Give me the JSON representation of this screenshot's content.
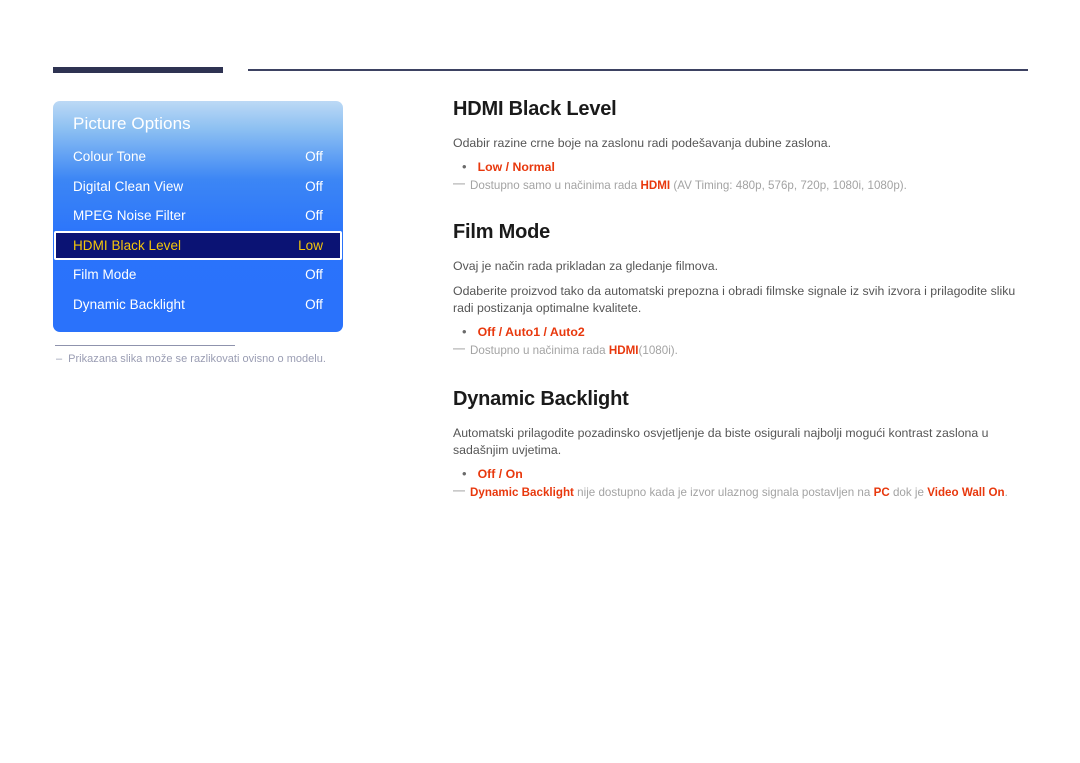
{
  "page": {
    "title": "Picture Options - HDMI Black Level / Film Mode / Dynamic Backlight",
    "accent_color": "#e8380d",
    "rule_color": "#2e3352",
    "osd_highlight_color": "#f5c60a",
    "osd_highlight_bg": "#0b1374"
  },
  "osd": {
    "title": "Picture Options",
    "rows": [
      {
        "label": "Colour Tone",
        "value": "Off",
        "selected": false
      },
      {
        "label": "Digital Clean View",
        "value": "Off",
        "selected": false
      },
      {
        "label": "MPEG Noise Filter",
        "value": "Off",
        "selected": false
      },
      {
        "label": "HDMI Black Level",
        "value": "Low",
        "selected": true
      },
      {
        "label": "Film Mode",
        "value": "Off",
        "selected": false
      },
      {
        "label": "Dynamic Backlight",
        "value": "Off",
        "selected": false
      }
    ],
    "footnote_dash": "–",
    "footnote": "Prikazana slika može se razlikovati ovisno o modelu."
  },
  "sections": [
    {
      "title": "HDMI Black Level",
      "paragraphs": [
        "Odabir razine crne boje na zaslonu radi podešavanja dubine zaslona."
      ],
      "bullet": "•",
      "options": "Low / Normal",
      "note_dash": "▬",
      "note": {
        "pre": "Dostupno samo u načinima rada ",
        "hl1": "HDMI",
        "post": " (AV Timing: 480p, 576p, 720p, 1080i, 1080p)."
      }
    },
    {
      "title": "Film Mode",
      "paragraphs": [
        "Ovaj je način rada prikladan za gledanje filmova.",
        "Odaberite proizvod tako da automatski prepozna i obradi filmske signale iz svih izvora i prilagodite sliku radi postizanja optimalne kvalitete."
      ],
      "bullet": "•",
      "options": "Off / Auto1 / Auto2",
      "note_dash": "▬",
      "note": {
        "pre": "Dostupno u načinima rada ",
        "hl1": "HDMI",
        "post": "(1080i)."
      }
    },
    {
      "title": "Dynamic Backlight",
      "paragraphs": [
        "Automatski prilagodite pozadinsko osvjetljenje da biste osigurali najbolji mogući kontrast zaslona u sadašnjim uvjetima."
      ],
      "bullet": "•",
      "options": "Off / On",
      "note_dash": "▬",
      "note": {
        "hl0": "Dynamic Backlight",
        "mid1": " nije dostupno kada je izvor ulaznog signala postavljen na ",
        "hl1": "PC",
        "mid2": " dok je ",
        "hl2": "Video Wall On",
        "post": "."
      }
    }
  ]
}
